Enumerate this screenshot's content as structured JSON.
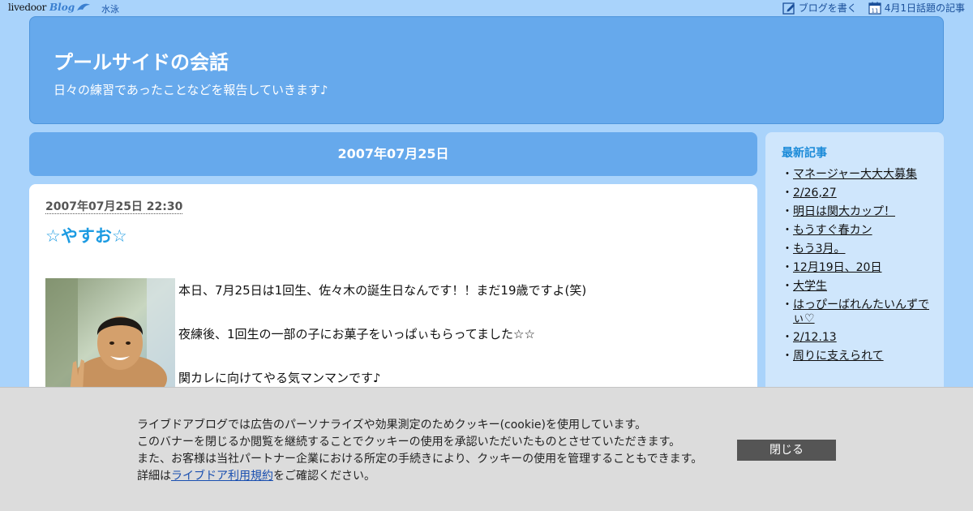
{
  "topbar": {
    "logo_text": "livedoor",
    "logo_blog": "Blog",
    "category_link": "水泳",
    "write_blog": "ブログを書く",
    "topic_article": "4月1日話題の記事",
    "calendar_day": "11"
  },
  "header": {
    "title": "プールサイドの会話",
    "description": "日々の練習であったことなどを報告していきます♪"
  },
  "date_bar": "2007年07月25日",
  "article": {
    "timestamp": "2007年07月25日 22:30",
    "title": "☆やすお☆",
    "lines": [
      "本日、7月25日は1回生、佐々木の誕生日なんです！！まだ19歳ですよ(笑)",
      "夜練後、1回生の一部の子にお菓子をいっぱぃもらってました☆☆",
      "関カレに向けてやる気マンマンです♪"
    ]
  },
  "sidebar": {
    "title": "最新記事",
    "items": [
      "マネージャー大大大募集",
      "2/26,27",
      "明日は関大カップ！",
      "もうすぐ春カン",
      "もう3月。",
      "12月19日、20日",
      "大学生",
      "はっぴーばれんたいんずでぃ♡",
      "2/12.13",
      "周りに支えられて"
    ],
    "bullet": "・"
  },
  "cookie": {
    "line1": "ライブドアブログでは広告のパーソナライズや効果測定のためクッキー(cookie)を使用しています。",
    "line2": "このバナーを閉じるか閲覧を継続することでクッキーの使用を承認いただいたものとさせていただきます。",
    "line3": "また、お客様は当社パートナー企業における所定の手続きにより、クッキーの使用を管理することもできます。",
    "line4_prefix": "詳細は",
    "line4_link": "ライブドア利用規約",
    "line4_suffix": "をご確認ください。",
    "close_label": "閉じる"
  },
  "colors": {
    "background": "#a9d3fb",
    "header_blue": "#66a9ec",
    "title_blue": "#1c9be2",
    "sidebar_bg": "#cfe6fc",
    "cookie_bg": "#dcdcdc",
    "close_btn": "#555555"
  },
  "icons": [
    "livedoor-blog-logo",
    "pencil-edit-icon",
    "calendar-icon",
    "dolphin-icon"
  ]
}
